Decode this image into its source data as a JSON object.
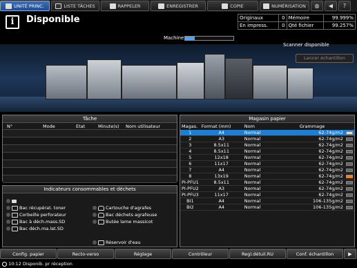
{
  "tabs": [
    {
      "label": "UNITÉ PRINC.",
      "icon": "printer-icon",
      "active": true
    },
    {
      "label": "LISTE TÂCHES",
      "icon": "list-icon",
      "active": false
    },
    {
      "label": "RAPPELER",
      "icon": "recall-icon",
      "active": false
    },
    {
      "label": "ENREGISTRER",
      "icon": "save-icon",
      "active": false
    },
    {
      "label": "COPIE",
      "icon": "copy-icon",
      "active": false
    },
    {
      "label": "NUMÉRISATION",
      "icon": "scan-icon",
      "active": false
    }
  ],
  "top_icons": [
    "globe-icon",
    "volume-icon",
    "help-icon"
  ],
  "header": {
    "status": "Disponible",
    "status_icon": "info-icon",
    "machine_label": "Machine",
    "machine_level": 0.2,
    "scanner_status": "Scanner disponible",
    "lancer_button": "Lancer échantillon"
  },
  "counters": {
    "originaux_label": "Originaux",
    "originaux_value": "0",
    "memoire_label": "Mémoire",
    "memoire_value": "99.999%",
    "impress_label": "En impress.",
    "impress_value": "0",
    "qte_label": "Qté fichier",
    "qte_value": "99.257%"
  },
  "tache": {
    "title": "Tâche",
    "columns": [
      "N°",
      "Mode",
      "Etat",
      "Minute(s)",
      "Nom utilisateur"
    ]
  },
  "indicateurs": {
    "title": "Indicateurs consommables et déchets",
    "items": [
      {
        "label": "Bac récupérat. toner",
        "icon": "toner-box-icon"
      },
      {
        "label": "Corbeille perforateur",
        "icon": "punch-icon"
      },
      {
        "label": "Bac à déch.mass.SD",
        "icon": "waste-icon"
      },
      {
        "label": "Bac déch.ma.lat.SD",
        "icon": "waste-icon"
      },
      {
        "label": "Cartouche d'agrafes",
        "icon": "staple-icon"
      },
      {
        "label": "Bac déchets agrafeuse",
        "icon": "staple-waste-icon"
      },
      {
        "label": "Butée lame massicot",
        "icon": "blade-icon"
      },
      {
        "label": "Réservoir d'eau",
        "icon": "water-tank-icon"
      }
    ]
  },
  "magasin": {
    "title": "Magasin papier",
    "columns": [
      "Magas.",
      "Format (mm)",
      "Nom",
      "Grammage"
    ],
    "rows": [
      {
        "id": "1",
        "format": "A4",
        "nom": "Normal",
        "grammage": "62-74g/m2",
        "level": "full",
        "selected": true
      },
      {
        "id": "2",
        "format": "A3",
        "nom": "Normal",
        "grammage": "62-74g/m2",
        "level": "mid"
      },
      {
        "id": "3",
        "format": "8.5x11",
        "nom": "Normal",
        "grammage": "62-74g/m2",
        "level": "mid"
      },
      {
        "id": "4",
        "format": "8.5x11",
        "nom": "Normal",
        "grammage": "62-74g/m2",
        "level": "mid"
      },
      {
        "id": "5",
        "format": "12x18",
        "nom": "Normal",
        "grammage": "62-74g/m2",
        "level": "mid"
      },
      {
        "id": "6",
        "format": "11x17",
        "nom": "Normal",
        "grammage": "62-74g/m2",
        "level": "mid"
      },
      {
        "id": "7",
        "format": "A4",
        "nom": "Normal",
        "grammage": "62-74g/m2",
        "level": "mid"
      },
      {
        "id": "8",
        "format": "13x19",
        "nom": "Normal",
        "grammage": "62-74g/m2",
        "level": "warn"
      },
      {
        "id": "PI-PFU1",
        "format": "8.5x11",
        "nom": "Normal",
        "grammage": "62-74g/m2",
        "level": "mid"
      },
      {
        "id": "PI-PFU2",
        "format": "A3",
        "nom": "Normal",
        "grammage": "62-74g/m2",
        "level": "mid"
      },
      {
        "id": "PI-PFU3",
        "format": "11x17",
        "nom": "Normal",
        "grammage": "62-74g/m2",
        "level": "mid"
      },
      {
        "id": "BI1",
        "format": "A4",
        "nom": "Normal",
        "grammage": "106-135g/m2",
        "level": "mid"
      },
      {
        "id": "BI2",
        "format": "A4",
        "nom": "Normal",
        "grammage": "106-135g/m2",
        "level": "mid"
      }
    ]
  },
  "bottom_buttons": [
    "Config. papier",
    "Recto-verso",
    "Réglage",
    "Contrôleur",
    "Regl.détuil.RU",
    "Conf. échantillon"
  ],
  "statusbar": {
    "time": "10:12",
    "text": "Disponib. pr réception"
  },
  "colors": {
    "accent": "#1d7ed6",
    "machine_bar": "#4aa3ff",
    "warn": "#f08020"
  }
}
